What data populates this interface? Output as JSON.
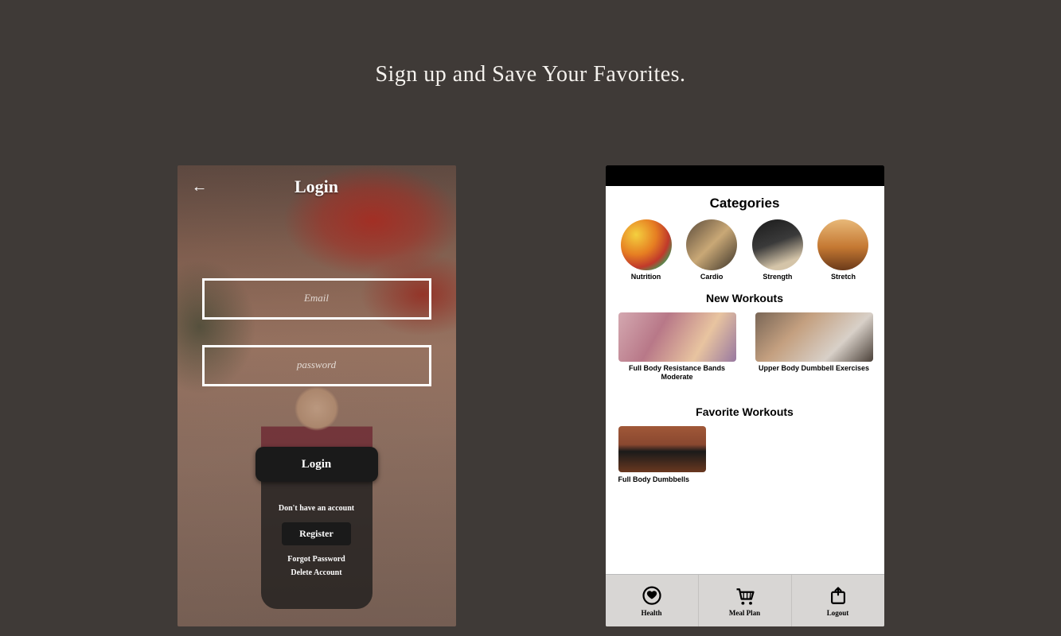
{
  "headline": "Sign up and Save Your Favorites.",
  "login": {
    "title": "Login",
    "email_placeholder": "Email",
    "password_placeholder": "password",
    "login_btn": "Login",
    "no_account": "Don't have an account",
    "register": "Register",
    "forgot": "Forgot Password",
    "delete": "Delete Account"
  },
  "categories": {
    "title": "Categories",
    "items": [
      {
        "label": "Nutrition"
      },
      {
        "label": "Cardio"
      },
      {
        "label": "Strength"
      },
      {
        "label": "Stretch"
      }
    ],
    "new_title": "New Workouts",
    "new": [
      {
        "title": "Full Body Resistance Bands Moderate"
      },
      {
        "title": "Upper Body Dumbbell Exercises"
      }
    ],
    "fav_title": "Favorite Workouts",
    "fav": [
      {
        "title": "Full Body Dumbbells"
      }
    ],
    "nav": [
      {
        "label": "Health"
      },
      {
        "label": "Meal Plan"
      },
      {
        "label": "Logout"
      }
    ]
  }
}
